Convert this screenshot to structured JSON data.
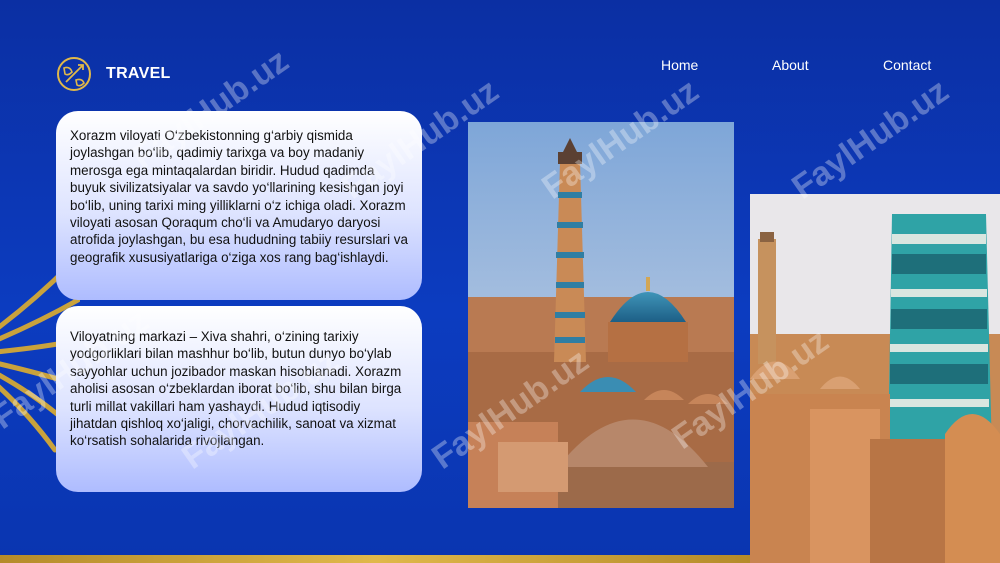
{
  "brand": {
    "name": "TRAVEL",
    "icon": "globe-plane-icon"
  },
  "nav": {
    "home": "Home",
    "about": "About",
    "contact": "Contact"
  },
  "cards": [
    {
      "text": "Xorazm viloyati O‘zbekistonning g‘arbiy qismida joylashgan bo‘lib, qadimiy tarixga va boy madaniy merosga ega mintaqalardan biridir. Hudud qadimda buyuk sivilizatsiyalar va savdo yo‘llarining kesishgan joyi bo‘lib, uning tarixi ming yilliklarni o‘z ichiga oladi. Xorazm viloyati asosan Qoraqum cho‘li va Amudaryo daryosi atrofida joylashgan, bu esa hududning tabiiy resurslari va geografik xususiyatlariga o‘ziga xos rang bag‘ishlaydi."
    },
    {
      "text": "Viloyatning markazi – Xiva shahri, o‘zining tarixiy yodgorliklari bilan mashhur bo‘lib, butun dunyo bo‘ylab sayyohlar uchun jozibador maskan hisoblanadi. Xorazm aholisi asosan o‘zbeklardan iborat bo‘lib, shu bilan birga turli millat vakillari ham yashaydi. Hudud iqtisodiy jihatdan qishloq xo‘jaligi, chorvachilik, sanoat va xizmat ko‘rsatish sohalarida rivojlangan."
    }
  ],
  "watermark": "FaylHub.uz",
  "colors": {
    "background": "#0c3cc0",
    "accent_gold": "#d9b04a",
    "card_top": "#ffffff",
    "card_bottom": "#aebcff"
  }
}
